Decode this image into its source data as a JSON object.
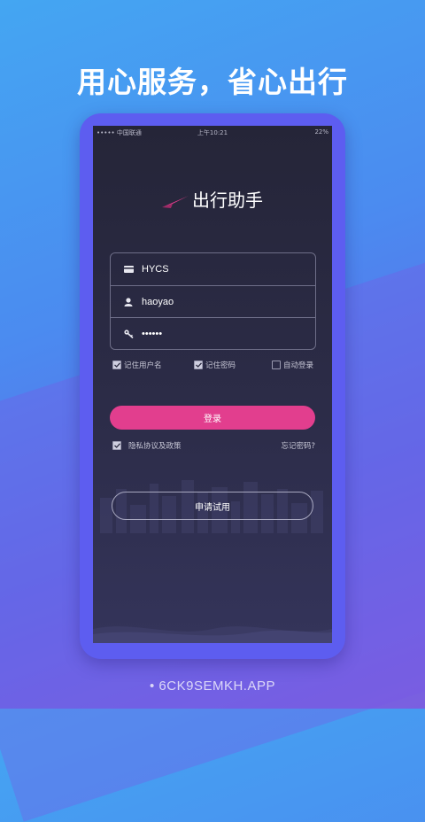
{
  "headline": "用心服务，省心出行",
  "status_bar": {
    "carrier": "••••• 中国联通",
    "time": "上午10:21",
    "battery": "22%"
  },
  "app": {
    "name": "出行助手",
    "brand_color": "#e23e8e"
  },
  "form": {
    "company": "HYCS",
    "username": "haoyao",
    "password": "••••••"
  },
  "options": {
    "remember_user": "记住用户名",
    "remember_password": "记住密码",
    "auto_login": "自动登录",
    "remember_user_checked": true,
    "remember_password_checked": true,
    "auto_login_checked": false
  },
  "login_button": "登录",
  "privacy": {
    "label": "隐私协议及政策",
    "checked": true
  },
  "forgot_password": "忘记密码?",
  "trial_button": "申请试用",
  "icons": [
    "card-icon",
    "user-icon",
    "key-icon",
    "paper-plane-icon"
  ],
  "footer": "• 6CK9SEMKH.APP"
}
